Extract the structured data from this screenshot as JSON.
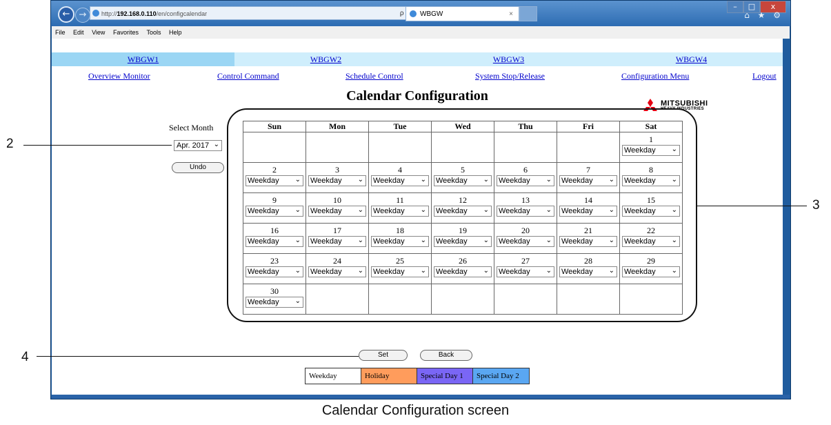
{
  "browser": {
    "url_prefix": "http://",
    "url_host": "192.168.0.110",
    "url_path": "/en/configcalendar",
    "search_symbols": "ρ - ¢",
    "tab_title": "WBGW",
    "tab_close": "×",
    "toolbar_icons": "⌂ ★ ⚙",
    "window_controls": {
      "minimize": "–",
      "maximize": "□",
      "close": "x"
    },
    "menu": [
      "File",
      "Edit",
      "View",
      "Favorites",
      "Tools",
      "Help"
    ]
  },
  "gateway_tabs": [
    "WBGW1",
    "WBGW2",
    "WBGW3",
    "WBGW4"
  ],
  "nav_links": [
    "Overview Monitor",
    "Control Command",
    "Schedule Control",
    "System Stop/Release",
    "Configuration Menu",
    "Logout"
  ],
  "page_title": "Calendar Configuration",
  "logo": {
    "line1": "MITSUBISHI",
    "line2": "HEAVY INDUSTRIES"
  },
  "month_select": {
    "label": "Select Month",
    "value": "Apr. 2017"
  },
  "buttons": {
    "undo": "Undo",
    "set": "Set",
    "back": "Back"
  },
  "calendar": {
    "weekdays": [
      "Sun",
      "Mon",
      "Tue",
      "Wed",
      "Thu",
      "Fri",
      "Sat"
    ],
    "weeks": [
      [
        "",
        "",
        "",
        "",
        "",
        "",
        "1"
      ],
      [
        "2",
        "3",
        "4",
        "5",
        "6",
        "7",
        "8"
      ],
      [
        "9",
        "10",
        "11",
        "12",
        "13",
        "14",
        "15"
      ],
      [
        "16",
        "17",
        "18",
        "19",
        "20",
        "21",
        "22"
      ],
      [
        "23",
        "24",
        "25",
        "26",
        "27",
        "28",
        "29"
      ],
      [
        "30",
        "",
        "",
        "",
        "",
        "",
        ""
      ]
    ],
    "day_type_value": "Weekday"
  },
  "legend": [
    {
      "label": "Weekday",
      "color": "#ffffff"
    },
    {
      "label": "Holiday",
      "color": "#ff9c5c"
    },
    {
      "label": "Special Day 1",
      "color": "#7a66f5"
    },
    {
      "label": "Special Day 2",
      "color": "#5aa7f2"
    }
  ],
  "callouts": [
    "2",
    "3",
    "4"
  ],
  "caption": "Calendar Configuration screen"
}
